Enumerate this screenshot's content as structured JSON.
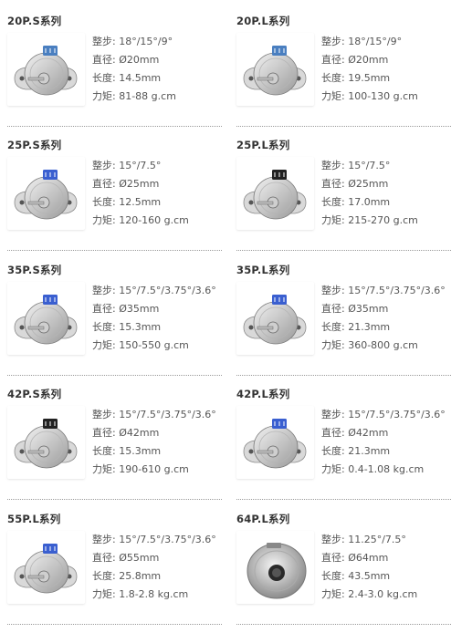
{
  "spec_labels": {
    "step": "整步",
    "diameter": "直径",
    "length": "长度",
    "torque": "力矩"
  },
  "products": [
    {
      "title": "20P.S系列",
      "step": "18°/15°/9°",
      "diameter": "Ø20mm",
      "length": "14.5mm",
      "torque": "81-88 g.cm",
      "connector_color": "#4a7fc0"
    },
    {
      "title": "20P.L系列",
      "step": "18°/15°/9°",
      "diameter": "Ø20mm",
      "length": "19.5mm",
      "torque": "100-130 g.cm",
      "connector_color": "#4a7fc0"
    },
    {
      "title": "25P.S系列",
      "step": "15°/7.5°",
      "diameter": "Ø25mm",
      "length": "12.5mm",
      "torque": "120-160 g.cm",
      "connector_color": "#3a5fd0"
    },
    {
      "title": "25P.L系列",
      "step": "15°/7.5°",
      "diameter": "Ø25mm",
      "length": "17.0mm",
      "torque": "215-270 g.cm",
      "connector_color": "#222222"
    },
    {
      "title": "35P.S系列",
      "step": "15°/7.5°/3.75°/3.6°",
      "diameter": "Ø35mm",
      "length": "15.3mm",
      "torque": "150-550 g.cm",
      "connector_color": "#3a5fd0"
    },
    {
      "title": "35P.L系列",
      "step": "15°/7.5°/3.75°/3.6°",
      "diameter": "Ø35mm",
      "length": "21.3mm",
      "torque": "360-800 g.cm",
      "connector_color": "#3a5fd0"
    },
    {
      "title": "42P.S系列",
      "step": "15°/7.5°/3.75°/3.6°",
      "diameter": "Ø42mm",
      "length": "15.3mm",
      "torque": "190-610 g.cm",
      "connector_color": "#222222"
    },
    {
      "title": "42P.L系列",
      "step": "15°/7.5°/3.75°/3.6°",
      "diameter": "Ø42mm",
      "length": "21.3mm",
      "torque": "0.4-1.08 kg.cm",
      "connector_color": "#3a5fd0"
    },
    {
      "title": "55P.L系列",
      "step": "15°/7.5°/3.75°/3.6°",
      "diameter": "Ø55mm",
      "length": "25.8mm",
      "torque": "1.8-2.8 kg.cm",
      "connector_color": "#3a5fd0"
    },
    {
      "title": "64P.L系列",
      "step": "11.25°/7.5°",
      "diameter": "Ø64mm",
      "length": "43.5mm",
      "torque": "2.4-3.0 kg.cm",
      "connector_color": "#888888"
    }
  ]
}
